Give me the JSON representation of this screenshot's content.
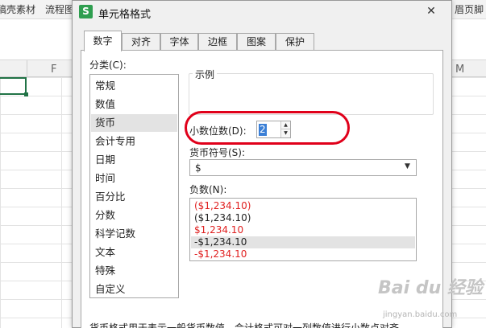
{
  "background": {
    "toolbar_items": [
      "稿壳素材",
      "流程图",
      "眉页脚"
    ],
    "column_letters": [
      "F",
      "M"
    ]
  },
  "dialog": {
    "title": "单元格格式",
    "app_icon_label": "S",
    "close_glyph": "✕",
    "tabs": [
      {
        "label": "数字",
        "active": true
      },
      {
        "label": "对齐"
      },
      {
        "label": "字体"
      },
      {
        "label": "边框"
      },
      {
        "label": "图案"
      },
      {
        "label": "保护"
      }
    ],
    "category": {
      "label": "分类(C):",
      "items": [
        "常规",
        "数值",
        "货币",
        "会计专用",
        "日期",
        "时间",
        "百分比",
        "分数",
        "科学记数",
        "文本",
        "特殊",
        "自定义"
      ],
      "selected": "货币"
    },
    "preview_label": "示例",
    "decimal_places": {
      "label": "小数位数(D):",
      "value": "2"
    },
    "currency_symbol": {
      "label": "货币符号(S):",
      "value": "$"
    },
    "negative_numbers": {
      "label": "负数(N):",
      "items": [
        {
          "text": "($1,234.10)",
          "color": "#e02020"
        },
        {
          "text": "($1,234.10)",
          "color": "#222222"
        },
        {
          "text": "$1,234.10",
          "color": "#e02020"
        },
        {
          "text": "-$1,234.10",
          "color": "#222222",
          "selected": true
        },
        {
          "text": "-$1,234.10",
          "color": "#e02020"
        }
      ]
    },
    "description": "货币格式用于表示一般货币数值。会计格式可对一列数值进行小数点对齐。"
  },
  "watermark": {
    "logo": "Bai du 经验",
    "url": "jingyan.baidu.com"
  },
  "colors": {
    "highlight": "#e0001a",
    "selection": "#3a7fd6",
    "negative_red": "#e02020",
    "sheet_selection": "#217346"
  }
}
